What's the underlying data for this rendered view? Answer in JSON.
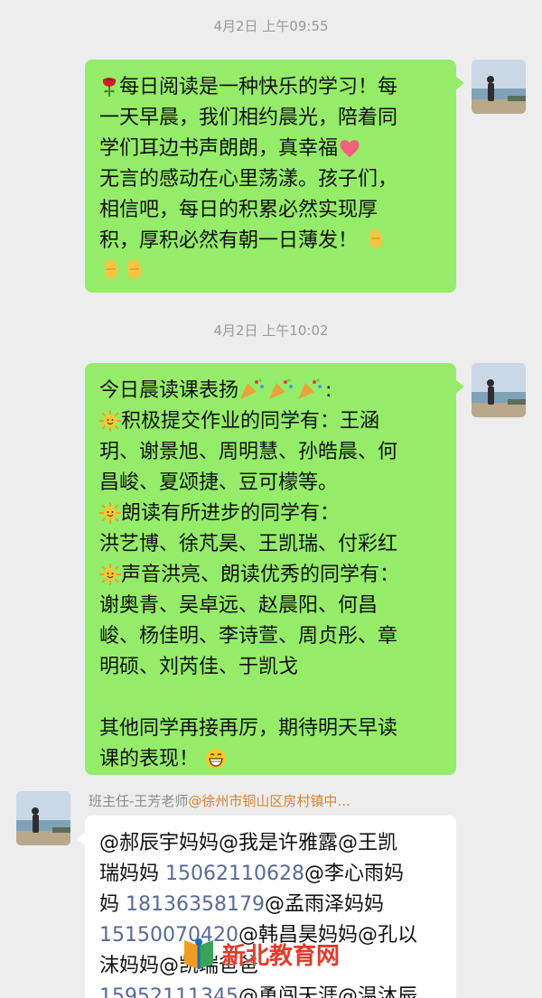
{
  "messages": [
    {
      "timestamp": "4月2日 上午09:55",
      "lines": [
        "每日阅读是一种快乐的学习！每",
        "一天早晨，我们相约晨光，陪着同",
        "学们耳边书声朗朗，真幸福",
        "无言的感动在心里荡漾。孩子们，",
        "相信吧，每日的积累必然实现厚",
        "积，厚积必然有朝一日薄发！"
      ],
      "emoji": [
        "rose-emoji",
        "heart-emoji",
        "clapping-hands-emoji"
      ]
    },
    {
      "timestamp": "4月2日 上午10:02",
      "lines": [
        "今日晨读课表扬",
        "积极提交作业的同学有：王涵",
        "玥、谢景旭、周明慧、孙皓晨、何",
        "昌峻、夏颂捷、豆可檬等。",
        "朗读有所进步的同学有：",
        "洪艺博、徐芃昊、王凯瑞、付彩红",
        "声音洪亮、朗读优秀的同学有：",
        "谢奥青、吴卓远、赵晨阳、何昌",
        "峻、杨佳明、李诗萱、周贞彤、章",
        "明硕、刘芮佳、于凯戈",
        "其他同学再接再厉，期待明天早读",
        "课的表现！"
      ],
      "emoji": [
        "party-popper-emoji",
        "sun-emoji",
        "grin-emoji"
      ]
    },
    {
      "sender_name": "班主任-王芳老师",
      "sender_org": "@徐州市铜山区房村镇中...",
      "parts": [
        "@郝辰宇妈妈@我是许雅露@王凯",
        "瑞妈妈 ",
        "15062110628",
        "@李心雨妈",
        "妈 ",
        "18136358179",
        "@孟雨泽妈妈",
        "15150070420",
        "@韩昌昊妈妈@孔以",
        "沫妈妈@",
        "凯瑞爸爸",
        "15952111345",
        "@勇闯天涯@温沐辰"
      ]
    }
  ],
  "watermark": {
    "text": "新北教育网"
  },
  "colors": {
    "background": "#ededed",
    "outgoing_bubble": "#95ec69",
    "incoming_bubble": "#ffffff",
    "timestamp": "#9a9a9a",
    "phone_link": "#576b95",
    "org_tag": "#d9822b",
    "watermark": "#e53b2c"
  }
}
